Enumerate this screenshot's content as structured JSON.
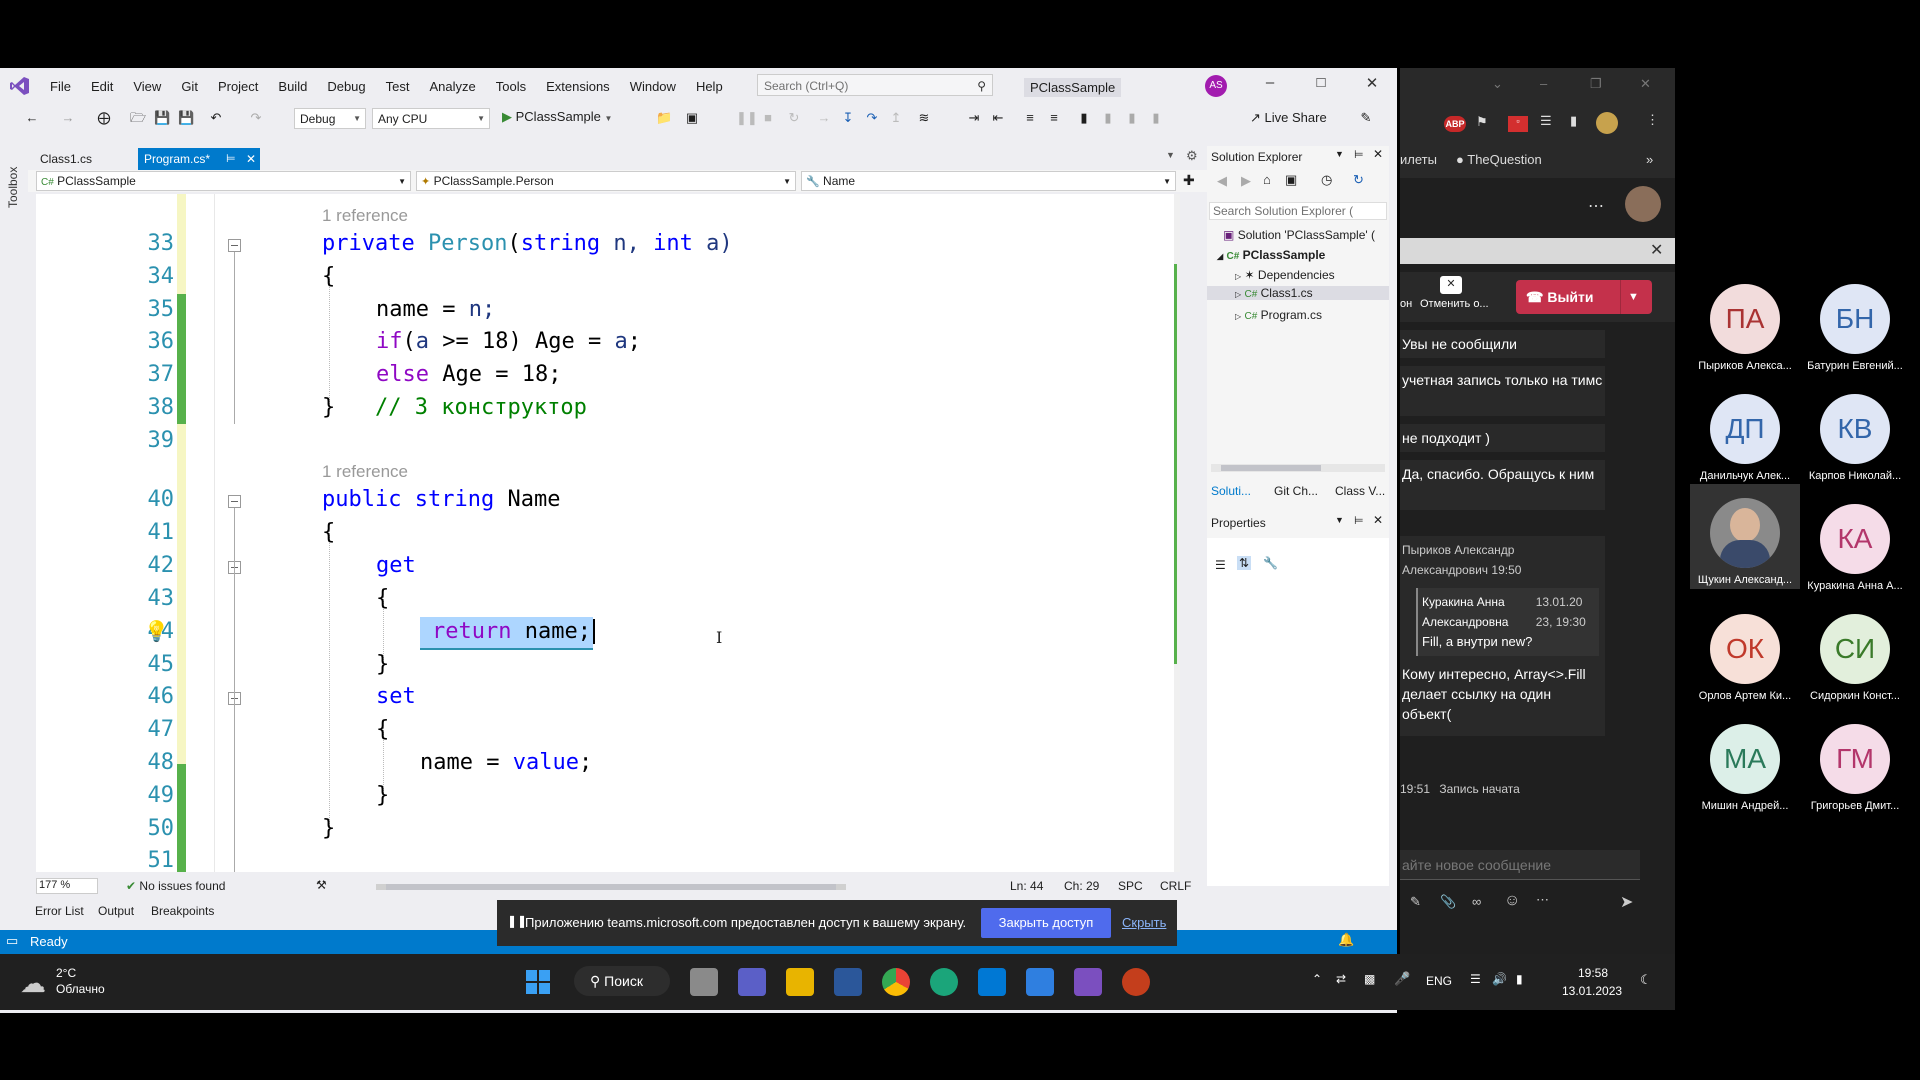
{
  "menu": [
    "File",
    "Edit",
    "View",
    "Git",
    "Project",
    "Build",
    "Debug",
    "Test",
    "Analyze",
    "Tools",
    "Extensions",
    "Window",
    "Help"
  ],
  "search": {
    "placeholder": "Search (Ctrl+Q)"
  },
  "project_title": "PClassSample",
  "user_initials": "AS",
  "toolbar": {
    "config": "Debug",
    "platform": "Any CPU",
    "run_target": "PClassSample",
    "live_share": "Live Share"
  },
  "side_label": "Toolbox",
  "tabs": [
    {
      "label": "Class1.cs"
    },
    {
      "label": "Program.cs*"
    }
  ],
  "nav": {
    "project": "PClassSample",
    "type": "PClassSample.Person",
    "member": "Name"
  },
  "code": {
    "ref_label": "1 reference",
    "line_numbers": [
      "33",
      "34",
      "35",
      "36",
      "37",
      "38",
      "39",
      "40",
      "41",
      "42",
      "43",
      "44",
      "45",
      "46",
      "47",
      "48",
      "49",
      "50",
      "51"
    ],
    "ctor_access": "private",
    "ctor_name": "Person",
    "ctor_params_open": "(",
    "ctor_string": "string",
    "ctor_n": " n, ",
    "ctor_int": "int",
    "ctor_a": " a)",
    "brace_open": "{",
    "brace_close": "}",
    "l35_lhs": "name = ",
    "l35_rhs": "n;",
    "l36_if": "if",
    "l36_cond_open": "(",
    "l36_cond_var": "a",
    "l36_rest": " >= 18) Age = ",
    "l36_a": "a",
    "semicolon": ";",
    "l37_else": "else",
    "l37_rest": " Age = 18;",
    "l38_comment": "// 3 конструктор",
    "l40_public": "public",
    "l40_string": "string",
    "l40_name": " Name",
    "l42_get": "get",
    "l44_return": "return",
    "l44_rest": " name;",
    "l46_set": "set",
    "l48_lhs": "name = ",
    "l48_value": "value",
    "cursor_glyph": "I"
  },
  "editor_status": {
    "zoom": "177 %",
    "issues": "No issues found",
    "ln": "Ln: 44",
    "ch": "Ch: 29",
    "spc": "SPC",
    "crlf": "CRLF"
  },
  "bottom_tabs": [
    "Error List",
    "Output",
    "Breakpoints"
  ],
  "status": {
    "ready": "Ready"
  },
  "solution_explorer": {
    "title": "Solution Explorer",
    "search_placeholder": "Search Solution Explorer (",
    "solution": "Solution 'PClassSample' (",
    "project": "PClassSample",
    "items": [
      "Dependencies",
      "Class1.cs",
      "Program.cs"
    ],
    "bottom_tabs": [
      "Soluti...",
      "Git Ch...",
      "Class V..."
    ],
    "properties_title": "Properties"
  },
  "browser": {
    "bookmark1": "илеты",
    "bookmark2": "TheQuestion"
  },
  "teams": {
    "cancel_label": "Отменить о...",
    "on_label": "он",
    "leave": "Выйти",
    "messages": [
      "Увы не сообщили",
      "учетная запись только на тимс",
      "не подходит )",
      "Да, спасибо. Обращусь к ним"
    ],
    "sender": "Пыриков Александр Александрович",
    "sender_time": "19:50",
    "quote_author": "Куракина Анна Александровна",
    "quote_date": "13.01.20 23, 19:30",
    "quote_text": "Fill, а внутри new?",
    "reply": "Кому интересно, Array<>.Fill делает ссылку на один объект(",
    "event_time": "19:51",
    "event_text": "Запись начата",
    "compose_placeholder": "айте новое сообщение"
  },
  "participants": [
    {
      "initials": "ПА",
      "name": "Пыриков Алекса...",
      "bg": "#f2dcdc",
      "fg": "#a33"
    },
    {
      "initials": "БН",
      "name": "Батурин Евгений...",
      "bg": "#dfe6f5",
      "fg": "#36a"
    },
    {
      "initials": "ДП",
      "name": "Данильчук Алек...",
      "bg": "#dfe6f5",
      "fg": "#36a"
    },
    {
      "initials": "КВ",
      "name": "Карпов Николай...",
      "bg": "#dfe6f5",
      "fg": "#36a"
    },
    {
      "initials": "",
      "name": "Щукин Александ...",
      "bg": "#888",
      "fg": "#fff"
    },
    {
      "initials": "КА",
      "name": "Куракина Анна А...",
      "bg": "#f5dce8",
      "fg": "#b3366b"
    },
    {
      "initials": "ОК",
      "name": "Орлов Артем Ки...",
      "bg": "#f7e0d8",
      "fg": "#c0392b"
    },
    {
      "initials": "СИ",
      "name": "Сидоркин Конст...",
      "bg": "#e2efdc",
      "fg": "#3a7a2a"
    },
    {
      "initials": "МА",
      "name": "Мишин Андрей...",
      "bg": "#dcefe8",
      "fg": "#2a7a5a"
    },
    {
      "initials": "ГМ",
      "name": "Григорьев Дмит...",
      "bg": "#f5dce8",
      "fg": "#b3366b"
    }
  ],
  "share_banner": {
    "text": "Приложению teams.microsoft.com предоставлен доступ к вашему экрану.",
    "stop": "Закрыть доступ",
    "hide": "Скрыть"
  },
  "taskbar": {
    "temp": "2°C",
    "weather": "Облачно",
    "search": "Поиск",
    "lang": "ENG",
    "time": "19:58",
    "date": "13.01.2023"
  }
}
